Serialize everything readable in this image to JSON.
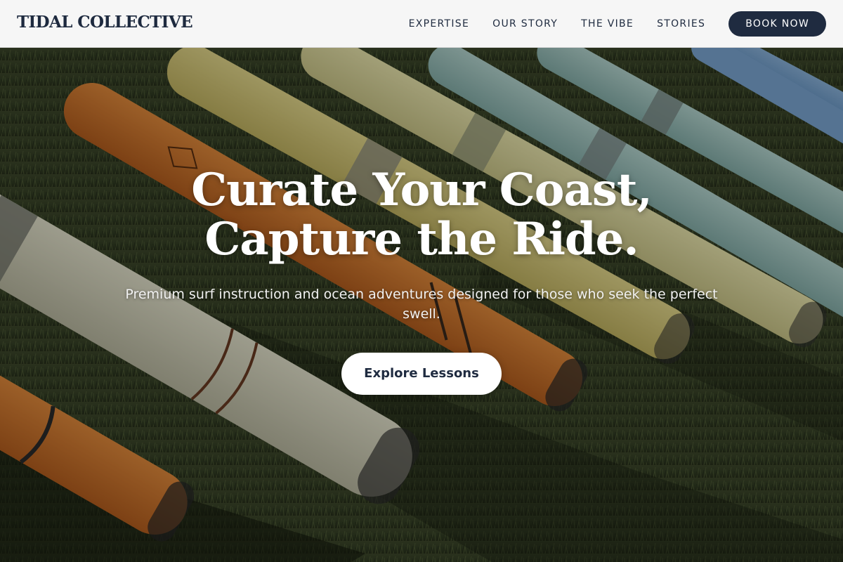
{
  "brand": {
    "name": "TIDAL COLLECTIVE"
  },
  "nav": {
    "links": [
      {
        "label": "EXPERTISE"
      },
      {
        "label": "OUR STORY"
      },
      {
        "label": "THE VIBE"
      },
      {
        "label": "STORIES"
      }
    ],
    "cta_label": "BOOK NOW"
  },
  "hero": {
    "title_line_1": "Curate Your Coast,",
    "title_line_2": "Capture the Ride.",
    "subtitle": "Premium surf instruction and ocean adventures designed for those who seek the perfect swell.",
    "cta_label": "Explore Lessons",
    "background_image": "surfboards-lined-up-on-grass-photo"
  },
  "colors": {
    "navy": "#1f2b40",
    "nav_background": "#f6f6f6",
    "white": "#ffffff",
    "grass_dark": "#2f3a22",
    "board_orange": "#d9772e",
    "board_yellow": "#d8cb7a",
    "board_teal": "#9cc3c0",
    "board_blue": "#6d9fd0"
  }
}
